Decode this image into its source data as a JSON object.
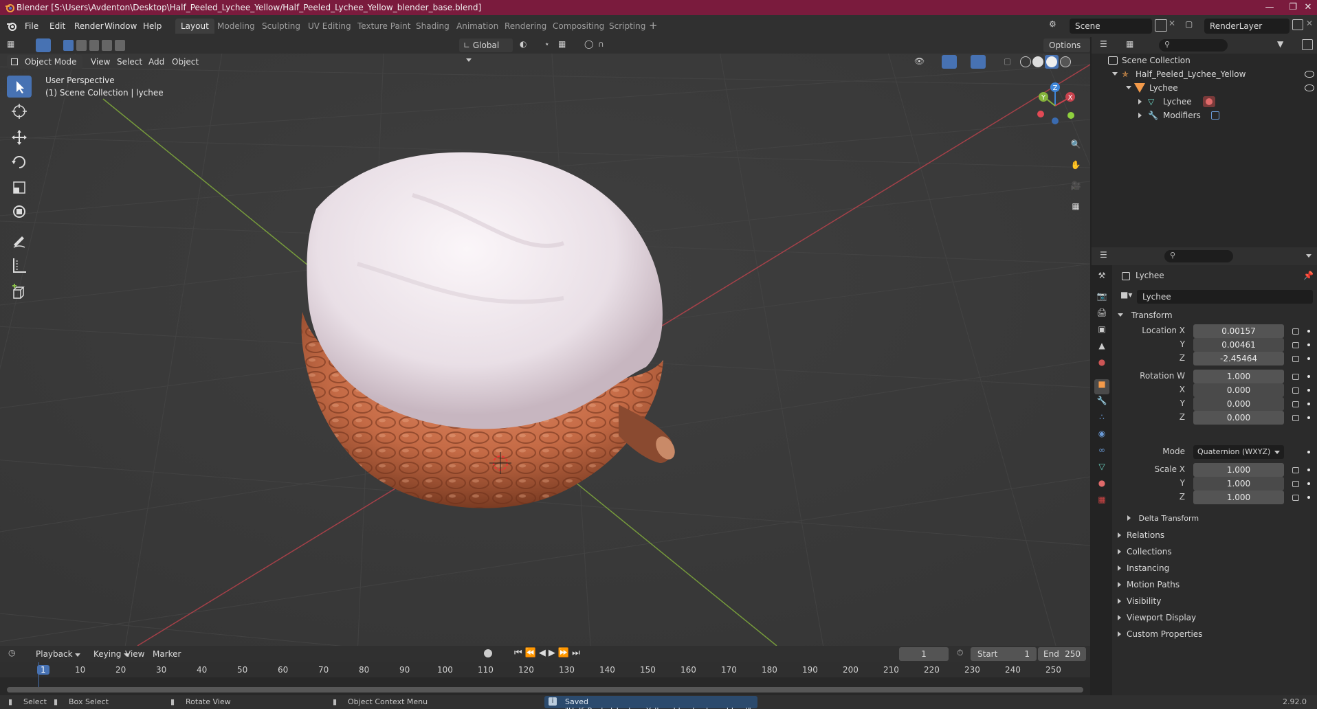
{
  "window": {
    "title": "Blender [S:\\Users\\Avdenton\\Desktop\\Half_Peeled_Lychee_Yellow/Half_Peeled_Lychee_Yellow_blender_base.blend]"
  },
  "menu": {
    "file": "File",
    "edit": "Edit",
    "render": "Render",
    "window": "Window",
    "help": "Help"
  },
  "workspaces": [
    "Layout",
    "Modeling",
    "Sculpting",
    "UV Editing",
    "Texture Paint",
    "Shading",
    "Animation",
    "Rendering",
    "Compositing",
    "Scripting"
  ],
  "scene": {
    "name": "Scene",
    "render_layer": "RenderLayer"
  },
  "viewport": {
    "transform_orientation": "Global",
    "options_label": "Options",
    "mode": "Object Mode",
    "menus": [
      "View",
      "Select",
      "Add",
      "Object"
    ],
    "overlay_line1": "User Perspective",
    "overlay_line2": "(1) Scene Collection | lychee",
    "gizmo": {
      "x": "X",
      "y": "Y",
      "z": "Z"
    },
    "colors": {
      "x_axis": "#c9434e",
      "y_axis": "#86b43c",
      "z_axis": "#3f86d8",
      "active": "#4772b3"
    }
  },
  "outliner": {
    "items": [
      {
        "label": "Scene Collection",
        "icon": "collection-icon"
      },
      {
        "label": "Half_Peeled_Lychee_Yellow",
        "icon": "armature-icon"
      },
      {
        "label": "Lychee",
        "icon": "object-icon"
      },
      {
        "label": "Lychee",
        "icon": "mesh-icon"
      },
      {
        "label": "Modifiers",
        "icon": "wrench-icon"
      }
    ]
  },
  "properties": {
    "object_name": "Lychee",
    "data_name": "Lychee",
    "transform_label": "Transform",
    "location": {
      "label_x": "Location X",
      "label_y": "Y",
      "label_z": "Z",
      "x": "0.00157",
      "y": "0.00461",
      "z": "-2.45464"
    },
    "rotation": {
      "label_w": "Rotation W",
      "label_x": "X",
      "label_y": "Y",
      "label_z": "Z",
      "w": "1.000",
      "x": "0.000",
      "y": "0.000",
      "z": "0.000"
    },
    "mode_label": "Mode",
    "mode_value": "Quaternion (WXYZ)",
    "scale": {
      "label_x": "Scale X",
      "label_y": "Y",
      "label_z": "Z",
      "x": "1.000",
      "y": "1.000",
      "z": "1.000"
    },
    "delta_transform": "Delta Transform",
    "sections": [
      "Relations",
      "Collections",
      "Instancing",
      "Motion Paths",
      "Visibility",
      "Viewport Display",
      "Custom Properties"
    ]
  },
  "timeline": {
    "menus": [
      "Playback",
      "Keying",
      "View",
      "Marker"
    ],
    "current_frame": "1",
    "start_label": "Start",
    "start": "1",
    "end_label": "End",
    "end": "250",
    "ticks": [
      "1",
      "10",
      "20",
      "30",
      "40",
      "50",
      "60",
      "70",
      "80",
      "90",
      "100",
      "110",
      "120",
      "130",
      "140",
      "150",
      "160",
      "170",
      "180",
      "190",
      "200",
      "210",
      "220",
      "230",
      "240",
      "250"
    ]
  },
  "statusbar": {
    "select": "Select",
    "box_select": "Box Select",
    "rotate_view": "Rotate View",
    "context_menu": "Object Context Menu",
    "message": "Saved \"Half_Peeled_Lychee_Yellow_blender_base.blend\"",
    "version": "2.92.0"
  }
}
